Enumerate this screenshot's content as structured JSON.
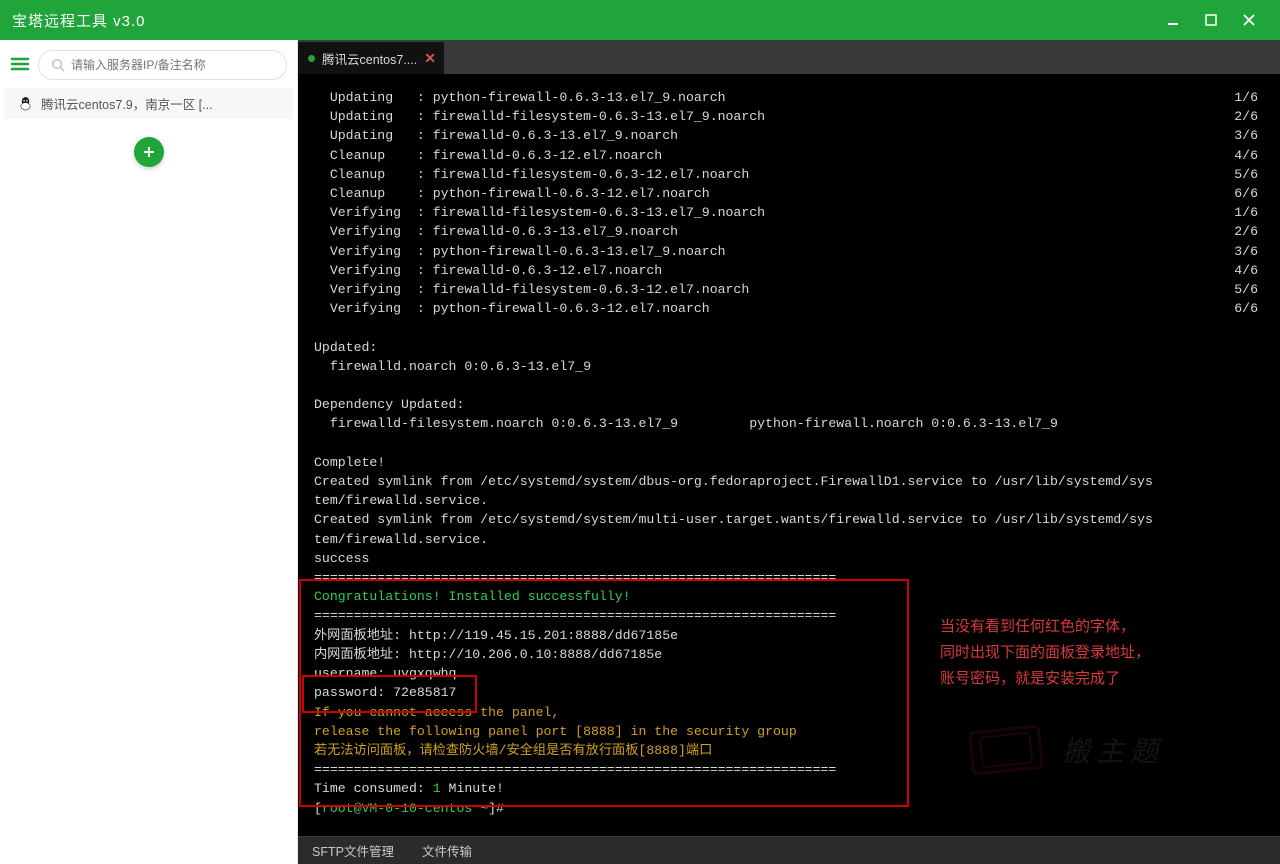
{
  "titlebar": {
    "title": "宝塔远程工具 v3.0"
  },
  "sidebar": {
    "search_placeholder": "请输入服务器IP/备注名称",
    "server_label": "腾讯云centos7.9，南京一区 [...",
    "add_aria": "add"
  },
  "tab": {
    "label": "腾讯云centos7...."
  },
  "term": {
    "rows": [
      {
        "op": "Updating  ",
        "pkg": "python-firewall-0.6.3-13.el7_9.noarch",
        "n": "1/6"
      },
      {
        "op": "Updating  ",
        "pkg": "firewalld-filesystem-0.6.3-13.el7_9.noarch",
        "n": "2/6"
      },
      {
        "op": "Updating  ",
        "pkg": "firewalld-0.6.3-13.el7_9.noarch",
        "n": "3/6"
      },
      {
        "op": "Cleanup   ",
        "pkg": "firewalld-0.6.3-12.el7.noarch",
        "n": "4/6"
      },
      {
        "op": "Cleanup   ",
        "pkg": "firewalld-filesystem-0.6.3-12.el7.noarch",
        "n": "5/6"
      },
      {
        "op": "Cleanup   ",
        "pkg": "python-firewall-0.6.3-12.el7.noarch",
        "n": "6/6"
      },
      {
        "op": "Verifying ",
        "pkg": "firewalld-filesystem-0.6.3-13.el7_9.noarch",
        "n": "1/6"
      },
      {
        "op": "Verifying ",
        "pkg": "firewalld-0.6.3-13.el7_9.noarch",
        "n": "2/6"
      },
      {
        "op": "Verifying ",
        "pkg": "python-firewall-0.6.3-13.el7_9.noarch",
        "n": "3/6"
      },
      {
        "op": "Verifying ",
        "pkg": "firewalld-0.6.3-12.el7.noarch",
        "n": "4/6"
      },
      {
        "op": "Verifying ",
        "pkg": "firewalld-filesystem-0.6.3-12.el7.noarch",
        "n": "5/6"
      },
      {
        "op": "Verifying ",
        "pkg": "python-firewall-0.6.3-12.el7.noarch",
        "n": "6/6"
      }
    ],
    "updated_hdr": "Updated:",
    "updated_line": "  firewalld.noarch 0:0.6.3-13.el7_9",
    "depupd_hdr": "Dependency Updated:",
    "depupd_line": "  firewalld-filesystem.noarch 0:0.6.3-13.el7_9         python-firewall.noarch 0:0.6.3-13.el7_9",
    "complete": "Complete!",
    "sym1": "Created symlink from /etc/systemd/system/dbus-org.fedoraproject.FirewallD1.service to /usr/lib/systemd/sys\ntem/firewalld.service.",
    "sym2": "Created symlink from /etc/systemd/system/multi-user.target.wants/firewalld.service to /usr/lib/systemd/sys\ntem/firewalld.service.",
    "success": "success",
    "sep": "==================================================================",
    "congrats": "Congratulations! Installed successfully!",
    "addr1": "外网面板地址: http://119.45.15.201:8888/dd67185e",
    "addr2": "内网面板地址: http://10.206.0.10:8888/dd67185e",
    "user": "username: uvgxqwhq",
    "pass": "password: 72e85817",
    "warn1": "If you cannot access the panel,",
    "warn2": "release the following panel port [8888] in the security group",
    "warn3": "若无法访问面板，请检查防火墙/安全组是否有放行面板[8888]端口",
    "time_pre": "Time consumed: ",
    "time_num": "1",
    "time_suf": " Minute!",
    "prompt_l": "[",
    "prompt_user": "root@VM-0-10-centos",
    "prompt_tilde": " ~",
    "prompt_r": "]# "
  },
  "note": {
    "l1": "当没有看到任何红色的字体，",
    "l2": "同时出现下面的面板登录地址，",
    "l3": "账号密码，就是安装完成了"
  },
  "bottombar": {
    "sftp": "SFTP文件管理",
    "file": "文件传输"
  },
  "watermark": {
    "text": "搬主题"
  }
}
